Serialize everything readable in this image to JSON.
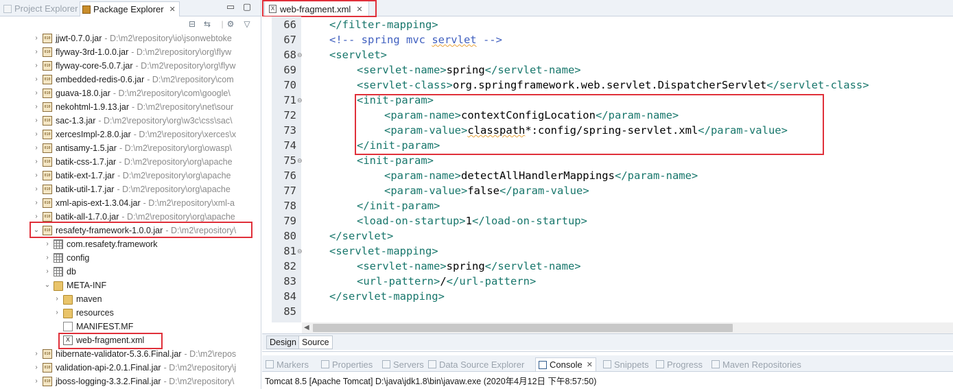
{
  "left_tabs": {
    "project_explorer": "Project Explorer",
    "package_explorer": "Package Explorer"
  },
  "tree": [
    {
      "label": "jjwt-0.7.0.jar",
      "path": "- D:\\m2\\repository\\io\\jsonwebtoke",
      "type": "jar",
      "level": 1,
      "expanded": false
    },
    {
      "label": "flyway-3rd-1.0.0.jar",
      "path": "- D:\\m2\\repository\\org\\flyw",
      "type": "jar",
      "level": 1,
      "expanded": false
    },
    {
      "label": "flyway-core-5.0.7.jar",
      "path": "- D:\\m2\\repository\\org\\flyw",
      "type": "jar",
      "level": 1,
      "expanded": false
    },
    {
      "label": "embedded-redis-0.6.jar",
      "path": "- D:\\m2\\repository\\com",
      "type": "jar",
      "level": 1,
      "expanded": false
    },
    {
      "label": "guava-18.0.jar",
      "path": "- D:\\m2\\repository\\com\\google\\",
      "type": "jar",
      "level": 1,
      "expanded": false
    },
    {
      "label": "nekohtml-1.9.13.jar",
      "path": "- D:\\m2\\repository\\net\\sour",
      "type": "jar",
      "level": 1,
      "expanded": false
    },
    {
      "label": "sac-1.3.jar",
      "path": "- D:\\m2\\repository\\org\\w3c\\css\\sac\\",
      "type": "jar",
      "level": 1,
      "expanded": false
    },
    {
      "label": "xercesImpl-2.8.0.jar",
      "path": "- D:\\m2\\repository\\xerces\\x",
      "type": "jar",
      "level": 1,
      "expanded": false
    },
    {
      "label": "antisamy-1.5.jar",
      "path": "- D:\\m2\\repository\\org\\owasp\\",
      "type": "jar",
      "level": 1,
      "expanded": false
    },
    {
      "label": "batik-css-1.7.jar",
      "path": "- D:\\m2\\repository\\org\\apache",
      "type": "jar",
      "level": 1,
      "expanded": false
    },
    {
      "label": "batik-ext-1.7.jar",
      "path": "- D:\\m2\\repository\\org\\apache",
      "type": "jar",
      "level": 1,
      "expanded": false
    },
    {
      "label": "batik-util-1.7.jar",
      "path": "- D:\\m2\\repository\\org\\apache",
      "type": "jar",
      "level": 1,
      "expanded": false
    },
    {
      "label": "xml-apis-ext-1.3.04.jar",
      "path": "- D:\\m2\\repository\\xml-a",
      "type": "jar",
      "level": 1,
      "expanded": false
    },
    {
      "label": "batik-all-1.7.0.jar",
      "path": "- D:\\m2\\repository\\org\\apache",
      "type": "jar",
      "level": 1,
      "expanded": false
    },
    {
      "label": "resafety-framework-1.0.0.jar",
      "path": "- D:\\m2\\repository\\",
      "type": "jar",
      "level": 1,
      "expanded": true
    },
    {
      "label": "com.resafety.framework",
      "path": "",
      "type": "pkg",
      "level": 2,
      "expanded": false
    },
    {
      "label": "config",
      "path": "",
      "type": "pkg",
      "level": 2,
      "expanded": false
    },
    {
      "label": "db",
      "path": "",
      "type": "pkg",
      "level": 2,
      "expanded": false
    },
    {
      "label": "META-INF",
      "path": "",
      "type": "folder-open",
      "level": 2,
      "expanded": true
    },
    {
      "label": "maven",
      "path": "",
      "type": "folder",
      "level": 3,
      "expanded": false
    },
    {
      "label": "resources",
      "path": "",
      "type": "folder",
      "level": 3,
      "expanded": false
    },
    {
      "label": "MANIFEST.MF",
      "path": "",
      "type": "file",
      "level": 3,
      "expanded": null
    },
    {
      "label": "web-fragment.xml",
      "path": "",
      "type": "xml",
      "level": 3,
      "expanded": null
    },
    {
      "label": "hibernate-validator-5.3.6.Final.jar",
      "path": "- D:\\m2\\repos",
      "type": "jar",
      "level": 1,
      "expanded": false
    },
    {
      "label": "validation-api-2.0.1.Final.jar",
      "path": "- D:\\m2\\repository\\j",
      "type": "jar",
      "level": 1,
      "expanded": false
    },
    {
      "label": "jboss-logging-3.3.2.Final.jar",
      "path": "- D:\\m2\\repository\\",
      "type": "jar",
      "level": 1,
      "expanded": false
    }
  ],
  "editor": {
    "tab_label": "web-fragment.xml",
    "lines": [
      {
        "n": "66",
        "fold": "",
        "indent": 0,
        "parts": [
          [
            "tag",
            "</filter-mapping>"
          ]
        ]
      },
      {
        "n": "67",
        "fold": "",
        "indent": 0,
        "parts": [
          [
            "cmt",
            "<!-- spring mvc "
          ],
          [
            "cmtsq",
            "servlet"
          ],
          [
            "cmt",
            " -->"
          ]
        ]
      },
      {
        "n": "68",
        "fold": "⊖",
        "indent": 0,
        "parts": [
          [
            "tag",
            "<servlet>"
          ]
        ]
      },
      {
        "n": "69",
        "fold": "",
        "indent": 1,
        "parts": [
          [
            "tag",
            "<servlet-name>"
          ],
          [
            "txt",
            "spring"
          ],
          [
            "tag",
            "</servlet-name>"
          ]
        ]
      },
      {
        "n": "70",
        "fold": "",
        "indent": 1,
        "parts": [
          [
            "tag",
            "<servlet-class>"
          ],
          [
            "txt",
            "org.springframework.web.servlet.DispatcherServlet"
          ],
          [
            "tag",
            "</servlet-class>"
          ]
        ]
      },
      {
        "n": "71",
        "fold": "⊖",
        "indent": 1,
        "parts": [
          [
            "tag",
            "<init-param>"
          ]
        ]
      },
      {
        "n": "72",
        "fold": "",
        "indent": 2,
        "parts": [
          [
            "tag",
            "<param-name>"
          ],
          [
            "txt",
            "contextConfigLocation"
          ],
          [
            "tag",
            "</param-name>"
          ]
        ]
      },
      {
        "n": "73",
        "fold": "",
        "indent": 2,
        "parts": [
          [
            "tag",
            "<param-value>"
          ],
          [
            "txtsq",
            "classpath"
          ],
          [
            "txt",
            "*:config/spring-servlet.xml"
          ],
          [
            "tag",
            "</param-value>"
          ]
        ]
      },
      {
        "n": "74",
        "fold": "",
        "indent": 1,
        "parts": [
          [
            "tag",
            "</init-param>"
          ]
        ]
      },
      {
        "n": "75",
        "fold": "⊖",
        "indent": 1,
        "parts": [
          [
            "tag",
            "<init-param>"
          ]
        ]
      },
      {
        "n": "76",
        "fold": "",
        "indent": 2,
        "parts": [
          [
            "tag",
            "<param-name>"
          ],
          [
            "txt",
            "detectAllHandlerMappings"
          ],
          [
            "tag",
            "</param-name>"
          ]
        ]
      },
      {
        "n": "77",
        "fold": "",
        "indent": 2,
        "parts": [
          [
            "tag",
            "<param-value>"
          ],
          [
            "txt",
            "false"
          ],
          [
            "tag",
            "</param-value>"
          ]
        ]
      },
      {
        "n": "78",
        "fold": "",
        "indent": 1,
        "parts": [
          [
            "tag",
            "</init-param>"
          ]
        ]
      },
      {
        "n": "79",
        "fold": "",
        "indent": 1,
        "parts": [
          [
            "tag",
            "<load-on-startup>"
          ],
          [
            "txt",
            "1"
          ],
          [
            "tag",
            "</load-on-startup>"
          ]
        ]
      },
      {
        "n": "80",
        "fold": "",
        "indent": 0,
        "parts": [
          [
            "tag",
            "</servlet>"
          ]
        ]
      },
      {
        "n": "81",
        "fold": "⊖",
        "indent": 0,
        "parts": [
          [
            "tag",
            "<servlet-mapping>"
          ]
        ]
      },
      {
        "n": "82",
        "fold": "",
        "indent": 1,
        "parts": [
          [
            "tag",
            "<servlet-name>"
          ],
          [
            "txt",
            "spring"
          ],
          [
            "tag",
            "</servlet-name>"
          ]
        ]
      },
      {
        "n": "83",
        "fold": "",
        "indent": 1,
        "parts": [
          [
            "tag",
            "<url-pattern>"
          ],
          [
            "txt",
            "/"
          ],
          [
            "tag",
            "</url-pattern>"
          ]
        ]
      },
      {
        "n": "84",
        "fold": "",
        "indent": 0,
        "parts": [
          [
            "tag",
            "</servlet-mapping>"
          ]
        ]
      },
      {
        "n": "85",
        "fold": "",
        "indent": 0,
        "parts": []
      }
    ],
    "mode_tabs": {
      "design": "Design",
      "source": "Source"
    }
  },
  "bottom": {
    "tabs": [
      "Markers",
      "Properties",
      "Servers",
      "Data Source Explorer",
      "Console",
      "Snippets",
      "Progress",
      "Maven Repositories"
    ],
    "active_tab": "Console",
    "console_line": "Tomcat 8.5 [Apache Tomcat] D:\\java\\jdk1.8\\bin\\javaw.exe (2020年4月12日 下午8:57:50)"
  },
  "colors": {
    "highlight_box": "#e0303a",
    "xml_tag": "#17766b",
    "xml_comment": "#3f5fbf"
  }
}
